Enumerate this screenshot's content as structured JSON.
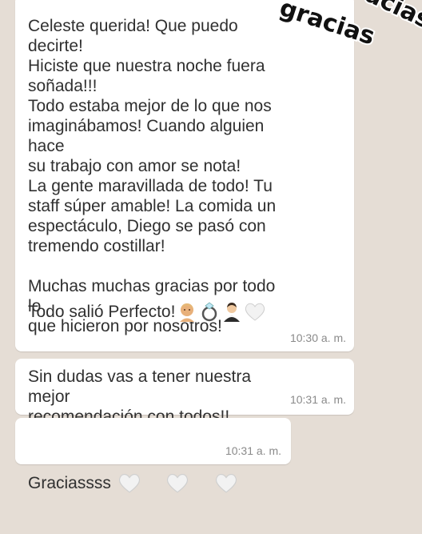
{
  "sticker": {
    "text1": "gracias",
    "text2": "gracias"
  },
  "messages": [
    {
      "text": "Celeste querida! Que puedo decirte!\nHiciste que nuestra noche fuera\nsoñada!!!\nTodo estaba mejor de lo que nos\nimaginábamos! Cuando alguien hace\nsu trabajo con amor se nota!\nLa gente maravillada de todo! Tu\nstaff súper amable! La comida un\nespectáculo, Diego se pasó con\ntremendo costillar!\n\nMuchas muchas gracias por todo lo\nque hicieron por nosotros!",
      "last_line": "Todo salió Perfecto!",
      "emojis": [
        "woman-icon",
        "ring-icon",
        "man-in-tuxedo-icon",
        "white-heart-icon"
      ],
      "time": "10:30 a. m."
    },
    {
      "text": "Sin dudas vas a tener nuestra mejor\nrecomendación con todos!!",
      "time": "10:31 a. m."
    },
    {
      "text": "Graciassss",
      "emojis": [
        "white-heart-icon",
        "white-heart-icon",
        "white-heart-icon"
      ],
      "time": "10:31 a. m."
    }
  ],
  "colors": {
    "chat_background": "#e5ddd5",
    "bubble": "#ffffff",
    "text": "#303030",
    "time": "#8a8a8a"
  }
}
